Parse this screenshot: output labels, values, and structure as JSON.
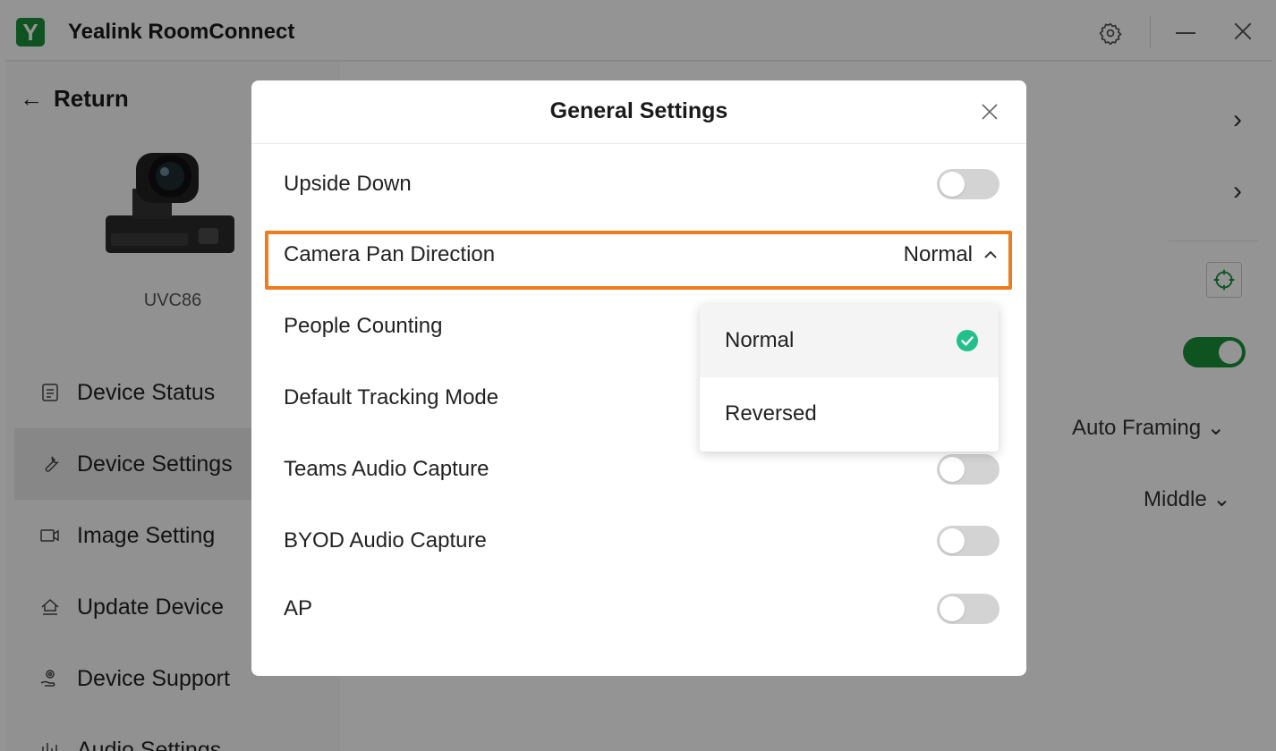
{
  "app": {
    "title": "Yealink RoomConnect",
    "logo_letter": "Y",
    "brand_color": "#1a8f3a"
  },
  "titlebar": {
    "icons": [
      "gear-icon",
      "minimize-icon",
      "close-icon"
    ]
  },
  "sidebar": {
    "return_label": "Return",
    "device_name": "UVC86",
    "items": [
      {
        "label": "Device Status",
        "icon": "document-icon",
        "active": false
      },
      {
        "label": "Device Settings",
        "icon": "wrench-icon",
        "active": true
      },
      {
        "label": "Image Setting",
        "icon": "video-camera-icon",
        "active": false
      },
      {
        "label": "Update Device",
        "icon": "upload-house-icon",
        "active": false
      },
      {
        "label": "Device Support",
        "icon": "support-hand-icon",
        "active": false
      },
      {
        "label": "Audio Settings",
        "icon": "equalizer-icon",
        "active": false
      }
    ]
  },
  "main": {
    "tracking_mode_value": "Auto Framing",
    "position_value": "Middle",
    "toggle_on": true
  },
  "dialog": {
    "title": "General Settings",
    "rows": [
      {
        "label": "Upside Down",
        "toggle": false
      },
      {
        "label": "Camera Pan Direction",
        "value": "Normal"
      },
      {
        "label": "People Counting"
      },
      {
        "label": "Default Tracking Mode"
      },
      {
        "label": "Teams Audio Capture",
        "toggle": false
      },
      {
        "label": "BYOD Audio Capture",
        "toggle": false
      },
      {
        "label": "AP",
        "toggle": false
      }
    ],
    "highlight_color": "#ee7b1c"
  },
  "dropdown": {
    "options": [
      {
        "label": "Normal",
        "selected": true
      },
      {
        "label": "Reversed",
        "selected": false
      }
    ],
    "check_color": "#22c08a"
  }
}
